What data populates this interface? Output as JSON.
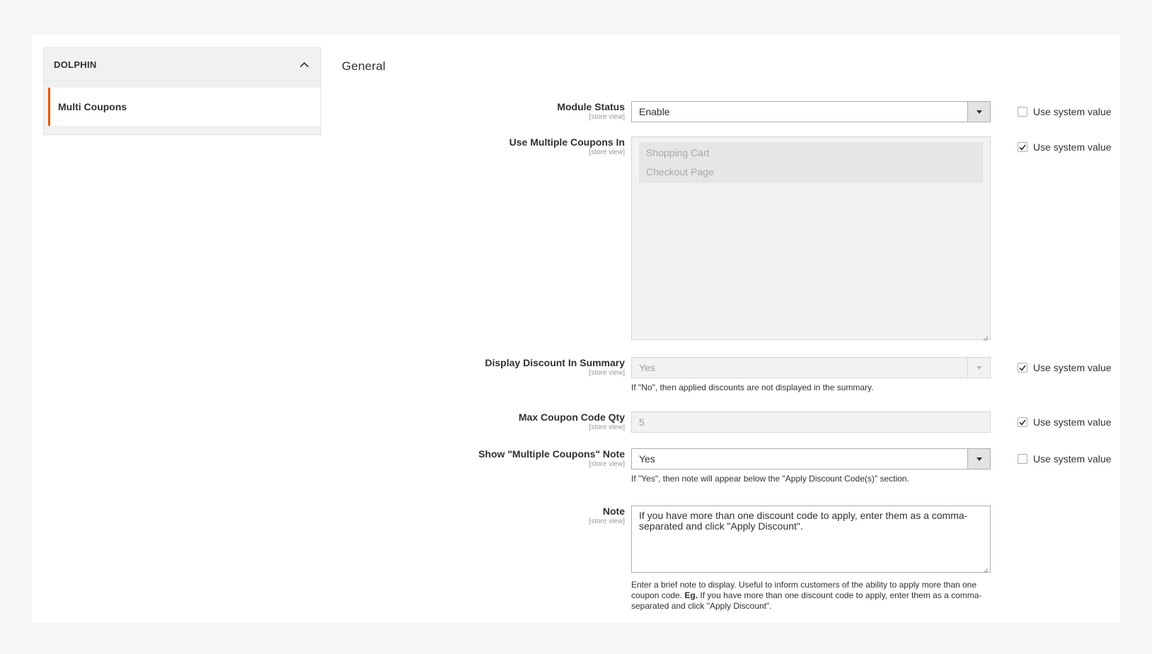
{
  "sidebar": {
    "group_title": "DOLPHIN",
    "items": [
      {
        "label": "Multi Coupons",
        "active": true
      }
    ]
  },
  "section": {
    "title": "General"
  },
  "scope_label": "[store view]",
  "use_system_value_label": "Use system value",
  "fields": {
    "module_status": {
      "label": "Module Status",
      "value": "Enable",
      "use_system_value": false,
      "disabled": false
    },
    "use_multiple_coupons_in": {
      "label": "Use Multiple Coupons In",
      "options": [
        "Shopping Cart",
        "Checkout Page"
      ],
      "use_system_value": true,
      "disabled": true
    },
    "display_discount_in_summary": {
      "label": "Display Discount In Summary",
      "value": "Yes",
      "use_system_value": true,
      "disabled": true,
      "comment": "If \"No\", then applied discounts are not displayed in the summary."
    },
    "max_coupon_code_qty": {
      "label": "Max Coupon Code Qty",
      "value": "5",
      "use_system_value": true,
      "disabled": true
    },
    "show_note": {
      "label": "Show \"Multiple Coupons\" Note",
      "value": "Yes",
      "use_system_value": false,
      "disabled": false,
      "comment": "If \"Yes\", then note will appear below the \"Apply Discount Code(s)\" section."
    },
    "note": {
      "label": "Note",
      "value": "If you have more than one discount code to apply, enter them as a comma-separated and click \"Apply Discount\".",
      "comment_pre": "Enter a brief note to display. Useful to inform customers of the ability to apply more than one coupon code. ",
      "comment_bold": "Eg.",
      "comment_post": " If you have more than one discount code to apply, enter them as a comma-separated and click \"Apply Discount\"."
    }
  },
  "colors": {
    "accent": "#eb5202",
    "text": "#303030",
    "panel_bg": "#ffffff",
    "page_bg": "#f7f7f7"
  }
}
